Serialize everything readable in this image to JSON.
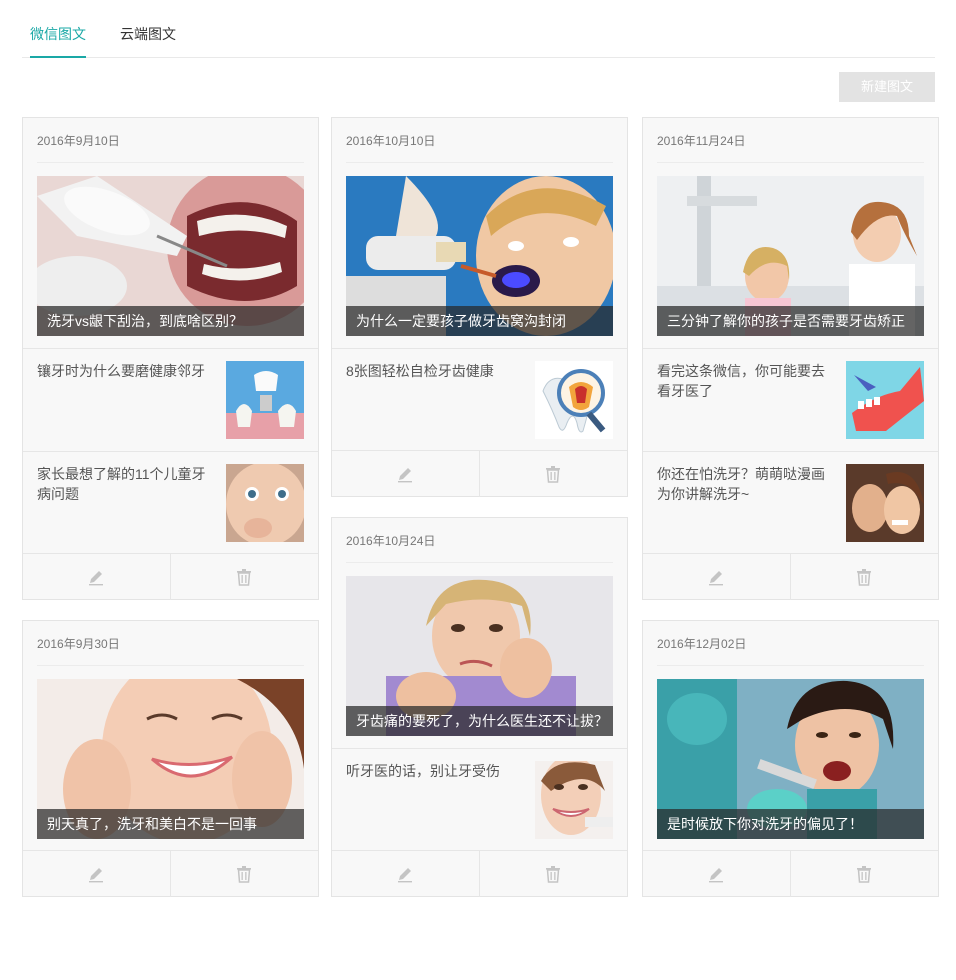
{
  "tabs": [
    {
      "label": "微信图文",
      "active": true
    },
    {
      "label": "云端图文",
      "active": false
    }
  ],
  "new_button": "新建图文",
  "accent_color": "#1aa8a6",
  "cards": [
    {
      "date": "2016年9月10日",
      "cover_title": "洗牙vs龈下刮治，到底啥区别？",
      "items": [
        {
          "title": "镶牙时为什么要磨健康邻牙"
        },
        {
          "title": "家长最想了解的11个儿童牙病问题"
        }
      ]
    },
    {
      "date": "2016年10月10日",
      "cover_title": "为什么一定要孩子做牙齿窝沟封闭",
      "items": [
        {
          "title": "8张图轻松自检牙齿健康"
        }
      ]
    },
    {
      "date": "2016年11月24日",
      "cover_title": "三分钟了解你的孩子是否需要牙齿矫正",
      "items": [
        {
          "title": "看完这条微信，你可能要去看牙医了"
        },
        {
          "title": "你还在怕洗牙？萌萌哒漫画为你讲解洗牙~"
        }
      ]
    },
    {
      "date": "2016年9月30日",
      "cover_title": "别天真了，洗牙和美白不是一回事",
      "items": []
    },
    {
      "date": "2016年10月24日",
      "cover_title": "牙齿痛的要死了，为什么医生还不让拔？",
      "items": [
        {
          "title": "听牙医的话，别让牙受伤"
        }
      ]
    },
    {
      "date": "2016年12月02日",
      "cover_title": "是时候放下你对洗牙的偏见了！",
      "items": []
    }
  ],
  "icons": {
    "edit": "pencil-icon",
    "delete": "trash-icon"
  }
}
